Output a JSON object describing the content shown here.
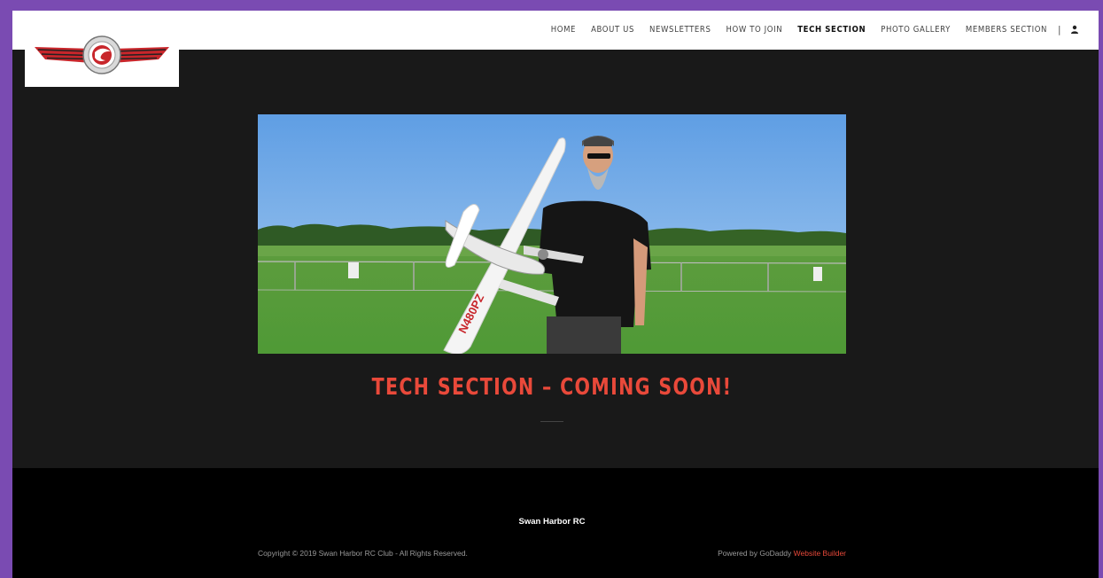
{
  "site": {
    "logo_icon": "swan-harbor-wings-logo",
    "colors": {
      "accent": "#e9493a",
      "frame": "#7a4bb2",
      "body_bg": "#191919",
      "footer_bg": "#000000"
    }
  },
  "nav": {
    "items": [
      {
        "label": "HOME"
      },
      {
        "label": "ABOUT US"
      },
      {
        "label": "NEWSLETTERS"
      },
      {
        "label": "HOW TO JOIN"
      },
      {
        "label": "TECH SECTION",
        "active": true
      },
      {
        "label": "PHOTO GALLERY"
      },
      {
        "label": "MEMBERS SECTION"
      }
    ],
    "separator": "|",
    "account_icon": "user-icon"
  },
  "main": {
    "hero_image": "man-holding-rc-airplane-photo",
    "plane_registration": "N480PZ",
    "heading": "TECH SECTION – COMING SOON!"
  },
  "footer": {
    "title": "Swan Harbor RC",
    "copyright": "Copyright © 2019 Swan Harbor RC Club - All Rights Reserved.",
    "powered_prefix": "Powered by GoDaddy",
    "powered_link": "Website Builder"
  }
}
